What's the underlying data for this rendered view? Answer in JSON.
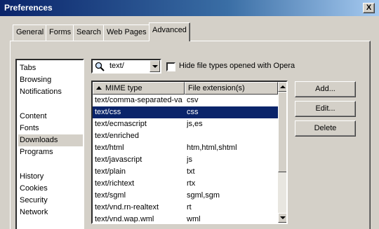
{
  "window": {
    "title": "Preferences",
    "close_label": "X"
  },
  "tabs": [
    {
      "label": "General"
    },
    {
      "label": "Forms"
    },
    {
      "label": "Search"
    },
    {
      "label": "Web Pages"
    },
    {
      "label": "Advanced",
      "active": true
    }
  ],
  "sidebar": {
    "items": [
      {
        "label": "Tabs"
      },
      {
        "label": "Browsing"
      },
      {
        "label": "Notifications"
      },
      {
        "label": "Content"
      },
      {
        "label": "Fonts"
      },
      {
        "label": "Downloads",
        "selected": true
      },
      {
        "label": "Programs"
      },
      {
        "label": "History"
      },
      {
        "label": "Cookies"
      },
      {
        "label": "Security"
      },
      {
        "label": "Network"
      }
    ]
  },
  "filter": {
    "value": "text/",
    "icon": "search-icon"
  },
  "hide_checkbox": {
    "label": "Hide file types opened with Opera",
    "checked": false
  },
  "table": {
    "headers": {
      "mime": "MIME type",
      "ext": "File extension(s)"
    },
    "rows": [
      {
        "mime": "text/comma-separated-val...",
        "ext": "csv"
      },
      {
        "mime": "text/css",
        "ext": "css",
        "selected": true
      },
      {
        "mime": "text/ecmascript",
        "ext": "js,es"
      },
      {
        "mime": "text/enriched",
        "ext": ""
      },
      {
        "mime": "text/html",
        "ext": "htm,html,shtml"
      },
      {
        "mime": "text/javascript",
        "ext": "js"
      },
      {
        "mime": "text/plain",
        "ext": "txt"
      },
      {
        "mime": "text/richtext",
        "ext": "rtx"
      },
      {
        "mime": "text/sgml",
        "ext": "sgml,sgm"
      },
      {
        "mime": "text/vnd.rn-realtext",
        "ext": "rt"
      },
      {
        "mime": "text/vnd.wap.wml",
        "ext": "wml"
      }
    ]
  },
  "buttons": {
    "add": "Add...",
    "edit": "Edit...",
    "delete": "Delete"
  },
  "colors": {
    "titlebar": "#0a246a",
    "selection": "#0a246a",
    "face": "#d4d0c8"
  }
}
